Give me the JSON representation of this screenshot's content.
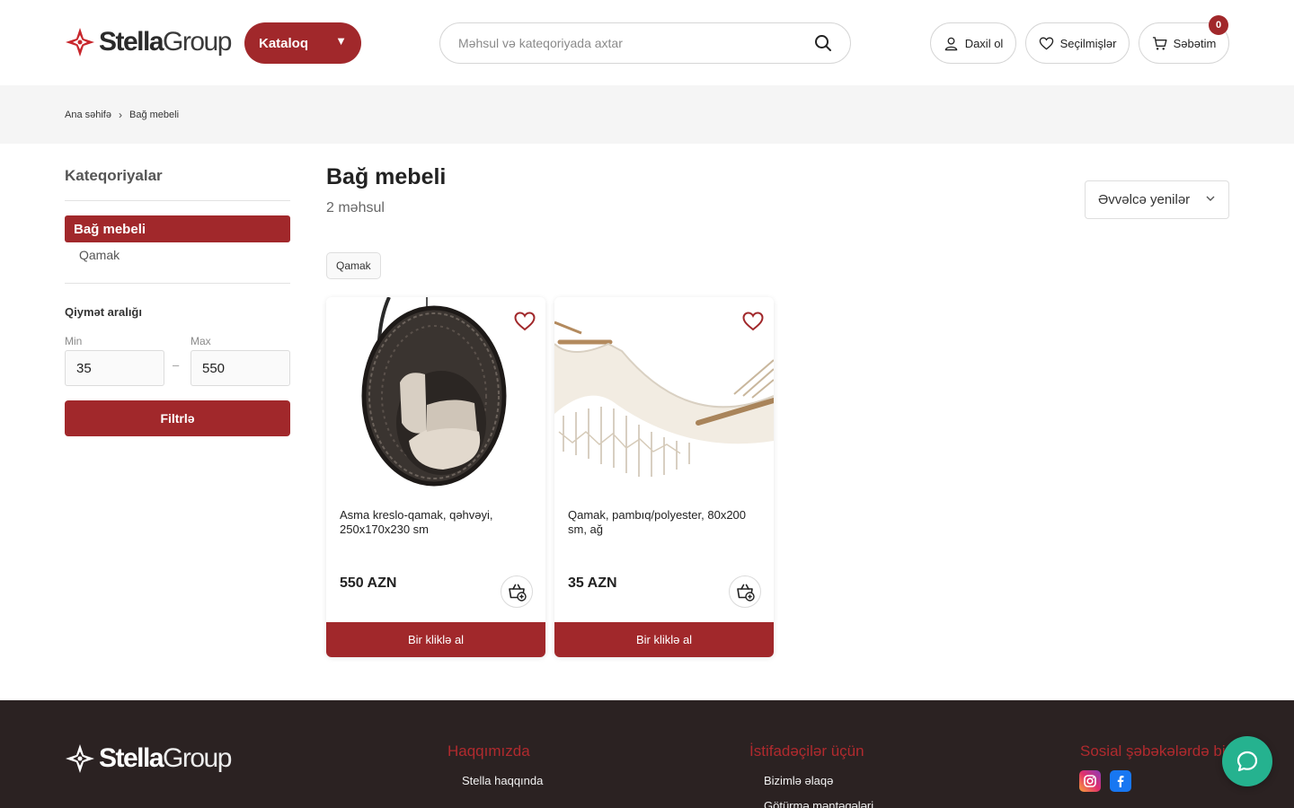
{
  "header": {
    "logo": {
      "part1": "Stella",
      "part2": "Group"
    },
    "catalog_label": "Kataloq",
    "search_placeholder": "Məhsul və kateqoriyada axtar",
    "login_label": "Daxil ol",
    "favorites_label": "Seçilmişlər",
    "cart_label": "Səbətim",
    "cart_count": "0"
  },
  "breadcrumb": {
    "home": "Ana səhifə",
    "current": "Bağ mebeli"
  },
  "sidebar": {
    "title": "Kateqoriyalar",
    "active_category": "Bağ mebeli",
    "subcategory": "Qamak",
    "price_title": "Qiymət aralığı",
    "min_label": "Min",
    "max_label": "Max",
    "min_value": "35",
    "max_value": "550",
    "filter_label": "Filtrlə"
  },
  "main": {
    "title": "Bağ mebeli",
    "count": "2 məhsul",
    "sort_label": "Əvvəlcə yenilər",
    "chip": "Qamak"
  },
  "products": [
    {
      "name": "Asma kreslo-qamak, qəhvəyi, 250x170x230 sm",
      "price": "550 AZN",
      "buy_label": "Bir kliklə al"
    },
    {
      "name": "Qamak, pambıq/polyester, 80x200 sm, ağ",
      "price": "35 AZN",
      "buy_label": "Bir kliklə al"
    }
  ],
  "footer": {
    "logo": {
      "part1": "Stella",
      "part2": "Group"
    },
    "col1_title": "Haqqımızda",
    "col1_links": [
      "Stella haqqında"
    ],
    "col2_title": "İstifadəçilər üçün",
    "col2_links": [
      "Bizimlə əlaqə",
      "Götürmə məntəqələri"
    ],
    "col3_title": "Sosial şəbəkələrdə biz",
    "social": [
      "instagram-icon",
      "facebook-icon"
    ]
  },
  "colors": {
    "brand": "#a1282b",
    "footer_bg": "#2b2222",
    "chat": "#25b28f"
  }
}
